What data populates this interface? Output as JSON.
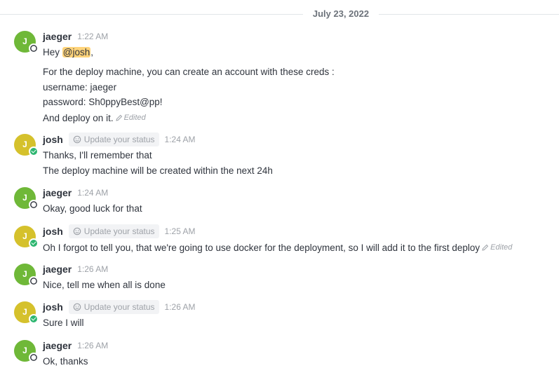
{
  "date_divider": "July 23, 2022",
  "colors": {
    "jaeger_avatar": "#6fb838",
    "josh_avatar": "#d5c12c"
  },
  "messages": [
    {
      "user": "jaeger",
      "initial": "J",
      "time": "1:22 AM",
      "mention_prefix": "Hey ",
      "mention": "@josh",
      "mention_suffix": ",",
      "lines": [
        "For the deploy machine, you can create an account with these creds :",
        "username: jaeger",
        "password: Sh0ppyBest@pp!",
        "And deploy on it."
      ],
      "edited": "Edited"
    },
    {
      "user": "josh",
      "initial": "J",
      "status_text": "Update your status",
      "time": "1:24 AM",
      "lines": [
        "Thanks, I'll remember that",
        "The deploy machine will be created within the next 24h"
      ]
    },
    {
      "user": "jaeger",
      "initial": "J",
      "time": "1:24 AM",
      "lines": [
        "Okay, good luck for that"
      ]
    },
    {
      "user": "josh",
      "initial": "J",
      "status_text": "Update your status",
      "time": "1:25 AM",
      "lines": [
        "Oh I forgot to tell you, that we're going to use docker for the deployment, so I will add it to the first deploy"
      ],
      "edited": "Edited"
    },
    {
      "user": "jaeger",
      "initial": "J",
      "time": "1:26 AM",
      "lines": [
        "Nice, tell me when all is done"
      ]
    },
    {
      "user": "josh",
      "initial": "J",
      "status_text": "Update your status",
      "time": "1:26 AM",
      "lines": [
        "Sure I will"
      ]
    },
    {
      "user": "jaeger",
      "initial": "J",
      "time": "1:26 AM",
      "lines": [
        "Ok, thanks"
      ]
    }
  ]
}
